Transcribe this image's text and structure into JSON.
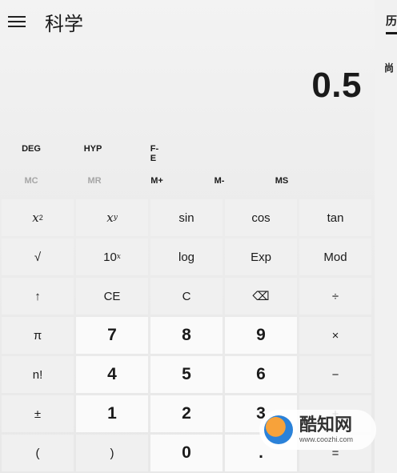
{
  "header": {
    "title": "科学",
    "menu_icon": "hamburger-icon"
  },
  "sidebar": {
    "tab": "历",
    "message": "尚"
  },
  "display": {
    "value": "0.5"
  },
  "modes": [
    "DEG",
    "HYP",
    "F-E"
  ],
  "memory": [
    {
      "label": "MC",
      "enabled": false
    },
    {
      "label": "MR",
      "enabled": false
    },
    {
      "label": "M+",
      "enabled": true
    },
    {
      "label": "M-",
      "enabled": true
    },
    {
      "label": "MS",
      "enabled": true
    }
  ],
  "keys": {
    "x_squared": "x",
    "x_squared_sup": "2",
    "x_power_y": "x",
    "x_power_y_sup": "y",
    "sin": "sin",
    "cos": "cos",
    "tan": "tan",
    "sqrt": "√",
    "ten_power": "10",
    "ten_power_sup": "x",
    "log": "log",
    "exp": "Exp",
    "mod": "Mod",
    "shift": "↑",
    "ce": "CE",
    "c": "C",
    "backspace": "⌫",
    "divide": "÷",
    "pi": "π",
    "seven": "7",
    "eight": "8",
    "nine": "9",
    "multiply": "×",
    "factorial": "n!",
    "four": "4",
    "five": "5",
    "six": "6",
    "minus": "−",
    "negate": "±",
    "one": "1",
    "two": "2",
    "three": "3",
    "plus": "+",
    "lparen": "(",
    "rparen": ")",
    "zero": "0",
    "decimal": ".",
    "equals": "="
  },
  "watermark": {
    "main": "酷知网",
    "url": "www.coozhi.com"
  }
}
